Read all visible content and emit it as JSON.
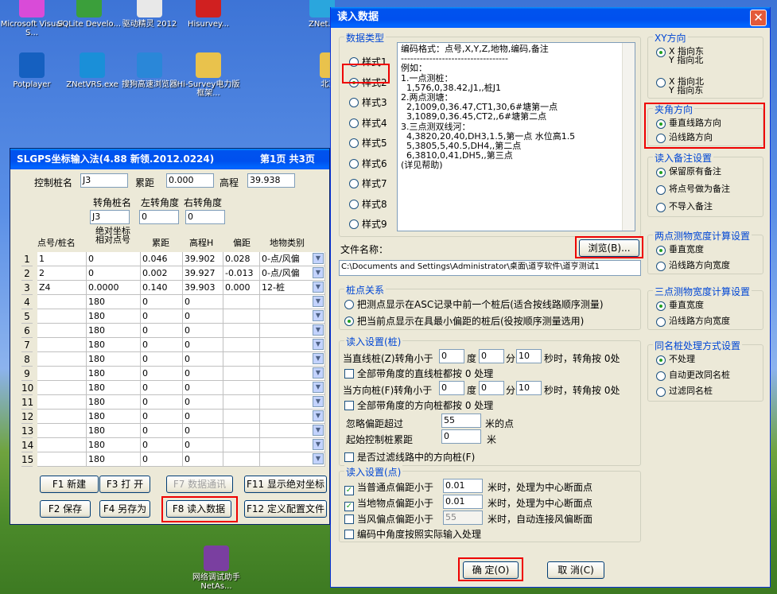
{
  "desktop_icons": [
    {
      "label": "Microsoft Visual S...",
      "color": "#d94bd8"
    },
    {
      "label": "SQLite Develo...",
      "color": "#3b9f3b"
    },
    {
      "label": "驱动精灵 2012",
      "color": "#e8e8e8"
    },
    {
      "label": "Hisurvey...",
      "color": "#d02020"
    },
    {
      "label": "ZNet...",
      "color": "#2aa6dd"
    },
    {
      "label": "Potplayer",
      "color": "#1560c0"
    },
    {
      "label": "ZNetVRS.exe",
      "color": "#1a8fd8"
    },
    {
      "label": "搜狗高速浏览器",
      "color": "#2a87d8"
    },
    {
      "label": "Hi-Survey电力版框架...",
      "color": "#e9c24c"
    },
    {
      "label": "北京...",
      "color": "#e9c24c"
    },
    {
      "label": "网络调试助手 NetAs...",
      "color": "#7a3fa0"
    }
  ],
  "slgps": {
    "title": "SLGPS坐标输入法(4.88 新领.2012.0224)",
    "page_info": "第1页 共3页",
    "ctrl_label": "控制桩名",
    "ctrl_value": "J3",
    "dist_label": "累距",
    "dist_value": "0.000",
    "elev_label": "高程",
    "elev_value": "39.938",
    "turn_label": "转角桩名",
    "turn_value": "J3",
    "left_label": "左转角度",
    "left_value": "0",
    "right_label": "右转角度",
    "right_value": "0",
    "headers": [
      "点号/桩名",
      "绝对坐标 相对点号",
      "累距",
      "高程H",
      "偏距",
      "地物类别"
    ],
    "rows": [
      [
        "1",
        "0",
        "0.046",
        "39.902",
        "0.028",
        "0-点/风偏"
      ],
      [
        "2",
        "0",
        "0.002",
        "39.927",
        "-0.013",
        "0-点/风偏"
      ],
      [
        "Z4",
        "0.0000",
        "0.140",
        "39.903",
        "0.000",
        "12-桩"
      ],
      [
        "",
        "180",
        "0",
        "0",
        "",
        ""
      ],
      [
        "",
        "180",
        "0",
        "0",
        "",
        ""
      ],
      [
        "",
        "180",
        "0",
        "0",
        "",
        ""
      ],
      [
        "",
        "180",
        "0",
        "0",
        "",
        ""
      ],
      [
        "",
        "180",
        "0",
        "0",
        "",
        ""
      ],
      [
        "",
        "180",
        "0",
        "0",
        "",
        ""
      ],
      [
        "",
        "180",
        "0",
        "0",
        "",
        ""
      ],
      [
        "",
        "180",
        "0",
        "0",
        "",
        ""
      ],
      [
        "",
        "180",
        "0",
        "0",
        "",
        ""
      ],
      [
        "",
        "180",
        "0",
        "0",
        "",
        ""
      ],
      [
        "",
        "180",
        "0",
        "0",
        "",
        ""
      ],
      [
        "",
        "180",
        "0",
        "0",
        "",
        ""
      ]
    ],
    "buttons": [
      "F1 新建",
      "F3 打 开",
      "F7 数据通讯",
      "F11 显示绝对坐标",
      "F2 保存",
      "F4 另存为",
      "F8 读入数据",
      "F12 定义配置文件"
    ]
  },
  "dialog": {
    "title": "读入数据",
    "data_type_legend": "数据类型",
    "styles": [
      "样式1",
      "样式2",
      "样式3",
      "样式4",
      "样式5",
      "样式6",
      "样式7",
      "样式8",
      "样式9"
    ],
    "selected_style": 1,
    "desc_lines": [
      "编码格式：点号,X,Y,Z,地物,编码,备注",
      "----------------------------------",
      "例如：",
      "1.一点测桩：",
      "  1,576,0,38.42,J1,,桩J1",
      "2.两点测塘：",
      "  2,1009,0,36.47,CT1,30,6#塘第一点",
      "  3,1089,0,36.45,CT2,,6#塘第二点",
      "3.三点测双线河：",
      "  4,3820,20,40,DH3,1.5,第一点 水位高1.5",
      "  5,3805,5,40.5,DH4,,第二点",
      "  6,3810,0,41,DH5,,第三点",
      "(详见帮助)"
    ],
    "file_label": "文件名称：",
    "browse": "浏览(B)...",
    "file_path": "C:\\Documents and Settings\\Administrator\\桌面\\道亨软件\\道亨测试1",
    "pile_legend": "桩点关系",
    "pile_opts": [
      "把测点显示在ASC记录中前一个桩后(适合按线路顺序测量)",
      "把当前点显示在具最小偏距的桩后(役按顺序测量选用)"
    ],
    "readpile_legend": "读入设置(桩)",
    "straight_label": "当直线桩(Z)转角小于",
    "deg": "度",
    "min": "分",
    "sec_tail": "秒时，转角按 0处",
    "straight_vals": [
      "0",
      "0",
      "10"
    ],
    "chk_straight": "全部带角度的直线桩都按 0 处理",
    "dir_label": "当方向桩(F)转角小于",
    "dir_vals": [
      "0",
      "0",
      "10"
    ],
    "chk_dir": "全部带角度的方向桩都按 0 处理",
    "ignore_label": "忽略偏距超过",
    "ignore_val": "55",
    "ignore_unit": "米的点",
    "start_label": "起始控制桩累距",
    "start_val": "0",
    "start_unit": "米",
    "chk_filter": "是否过滤线路中的方向桩(F)",
    "readpt_legend": "读入设置(点)",
    "pt_rows": [
      {
        "label": "当普通点偏距小于",
        "val": "0.01",
        "tail": "米时，处理为中心断面点",
        "checked": true
      },
      {
        "label": "当地物点偏距小于",
        "val": "0.01",
        "tail": "米时，处理为中心断面点",
        "checked": true
      },
      {
        "label": "当风偏点偏距小于",
        "val": "55",
        "tail": "米时，自动连接风偏断面",
        "checked": false
      }
    ],
    "chk_code": "编码中角度按照实际输入处理",
    "ok": "确  定(O)",
    "cancel": "取  消(C)",
    "xy_legend": "XY方向",
    "xy_opts": [
      "X 指向东\nY 指向北",
      "X 指向北\nY 指向东"
    ],
    "angle_legend": "夹角方向",
    "angle_opts": [
      "垂直线路方向",
      "沿线路方向"
    ],
    "remark_legend": "读入备注设置",
    "remark_opts": [
      "保留原有备注",
      "将点号做为备注",
      "不导入备注"
    ],
    "two_legend": "两点测物宽度计算设置",
    "two_opts": [
      "垂直宽度",
      "沿线路方向宽度"
    ],
    "three_legend": "三点测物宽度计算设置",
    "three_opts": [
      "垂直宽度",
      "沿线路方向宽度"
    ],
    "same_legend": "同名桩处理方式设置",
    "same_opts": [
      "不处理",
      "自动更改同名桩",
      "过滤同名桩"
    ]
  }
}
